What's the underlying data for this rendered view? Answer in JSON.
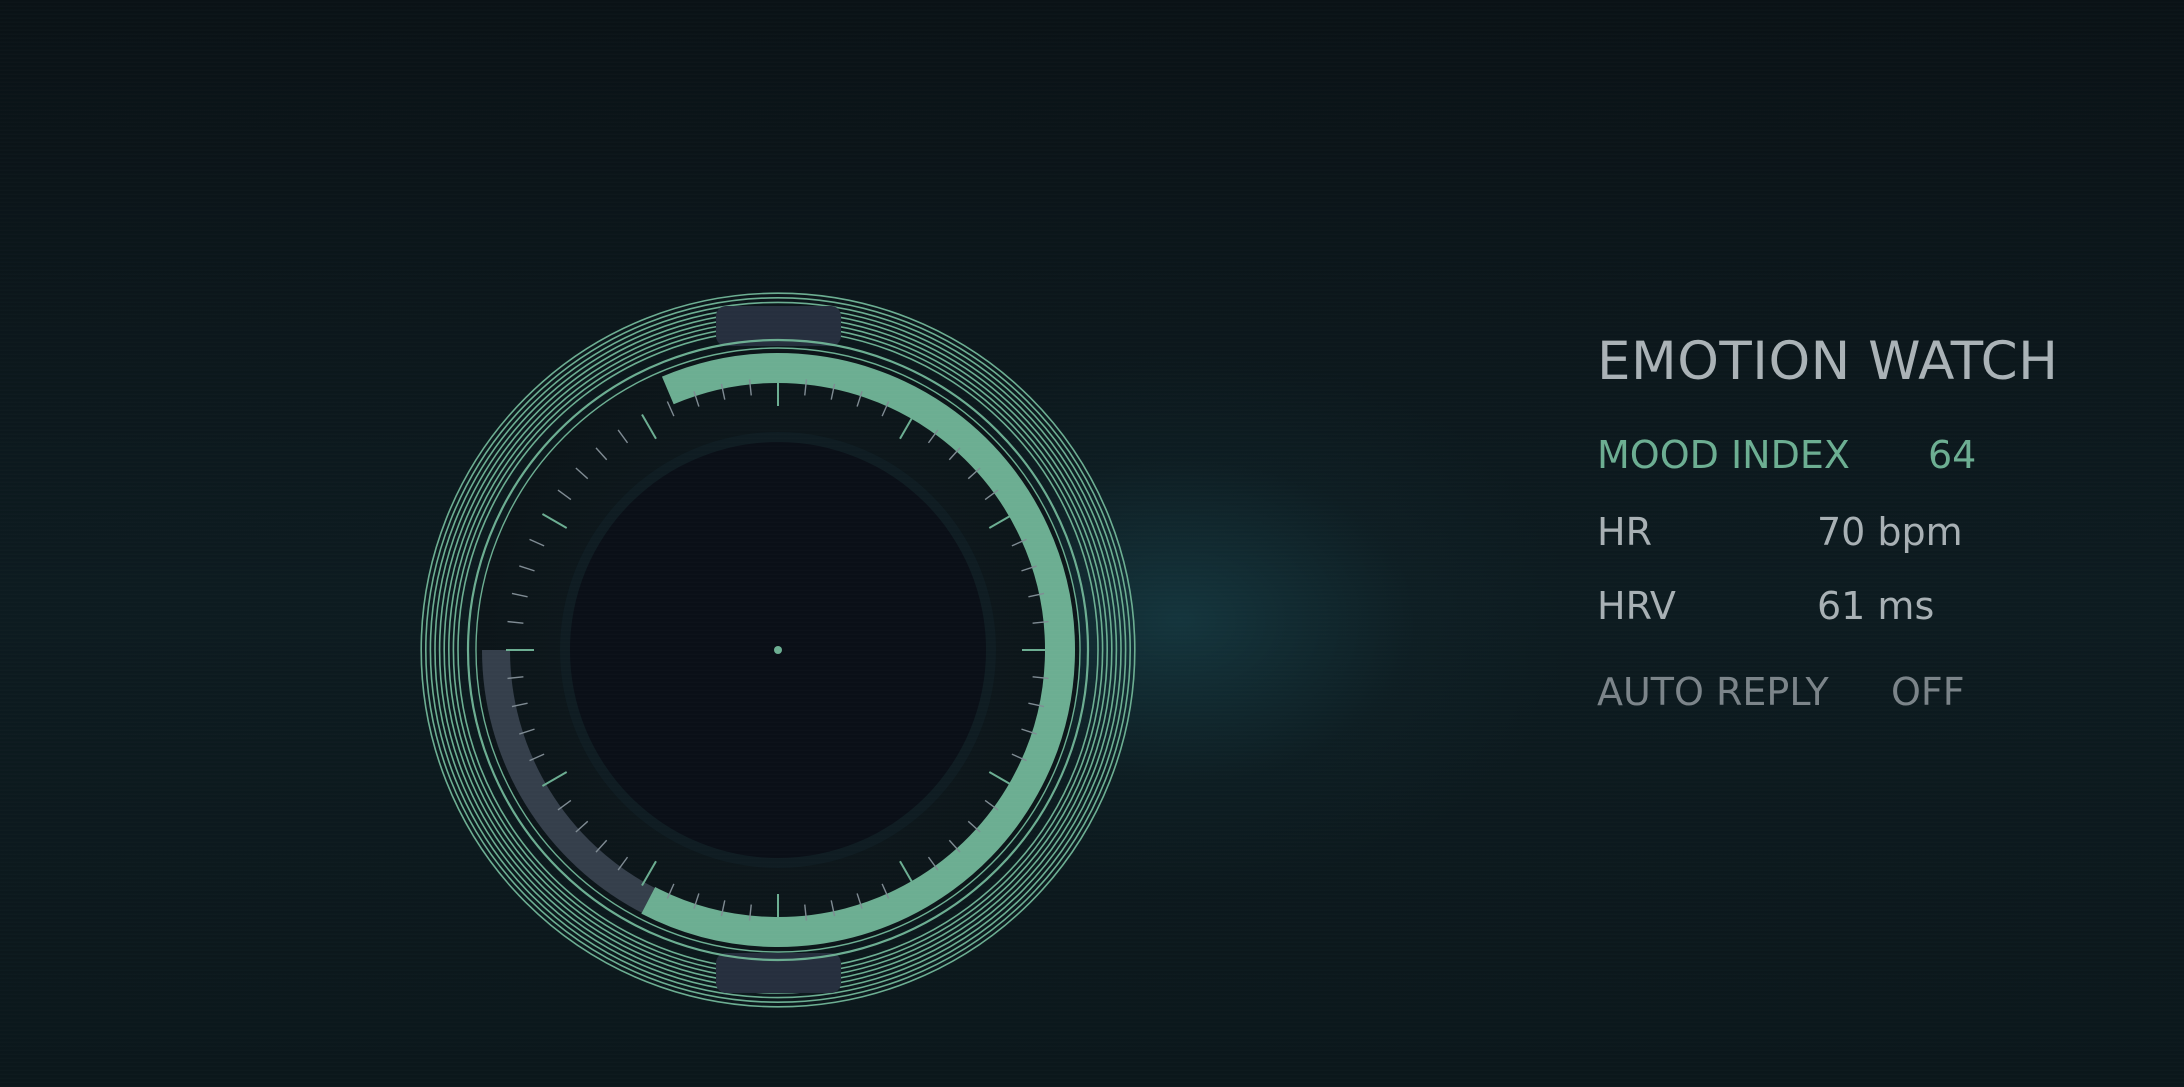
{
  "app": {
    "title": "EMOTION WATCH"
  },
  "metrics": {
    "mood_index": {
      "label": "MOOD INDEX",
      "value": "64"
    },
    "heart_rate": {
      "label": "HR",
      "value": "70 bpm"
    },
    "hrv": {
      "label": "HRV",
      "value": "61 ms"
    }
  },
  "settings": {
    "auto_reply": {
      "label": "AUTO REPLY",
      "value": "OFF"
    }
  },
  "dial": {
    "mood_level": 0.64
  },
  "colors": {
    "accent": "#6cae92",
    "background": "#0b1519",
    "face": "#0a0f17",
    "strap": "#262f3e",
    "track_inactive": "#353f4b",
    "text_primary": "#aab2b6",
    "text_muted": "#7b8489"
  },
  "icons": {
    "watch": "watch-face-icon"
  }
}
